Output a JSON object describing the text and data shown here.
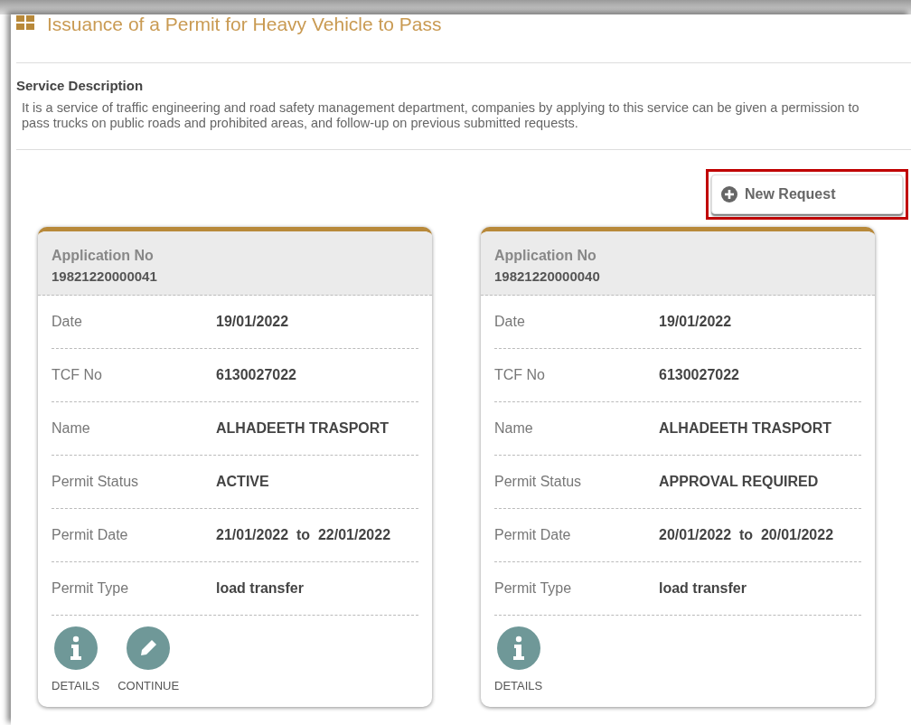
{
  "page": {
    "title": "Issuance of a Permit for Heavy Vehicle to Pass"
  },
  "service": {
    "heading": "Service Description",
    "description": "It is a service of traffic engineering and road safety management department, companies by applying to this service can be given a permission to pass trucks on public roads and prohibited areas, and follow-up on previous submitted requests."
  },
  "new_request": {
    "label": "New Request",
    "highlighted": true
  },
  "applications": [
    {
      "header_label": "Application No",
      "number": "19821220000041",
      "fields": [
        {
          "label": "Date",
          "value": "19/01/2022"
        },
        {
          "label": "TCF No",
          "value": "6130027022"
        },
        {
          "label": "Name",
          "value": "ALHADEETH TRASPORT"
        },
        {
          "label": "Permit Status",
          "value": "ACTIVE"
        },
        {
          "label": "Permit Date",
          "value": "21/01/2022  to  22/01/2022"
        },
        {
          "label": "Permit Type",
          "value": "load transfer"
        }
      ],
      "actions": [
        {
          "kind": "details",
          "label": "DETAILS"
        },
        {
          "kind": "continue",
          "label": "CONTINUE"
        }
      ]
    },
    {
      "header_label": "Application No",
      "number": "19821220000040",
      "fields": [
        {
          "label": "Date",
          "value": "19/01/2022"
        },
        {
          "label": "TCF No",
          "value": "6130027022"
        },
        {
          "label": "Name",
          "value": "ALHADEETH TRASPORT"
        },
        {
          "label": "Permit Status",
          "value": "APPROVAL REQUIRED"
        },
        {
          "label": "Permit Date",
          "value": "20/01/2022  to  20/01/2022"
        },
        {
          "label": "Permit Type",
          "value": "load transfer"
        }
      ],
      "actions": [
        {
          "kind": "details",
          "label": "DETAILS"
        }
      ]
    }
  ]
}
